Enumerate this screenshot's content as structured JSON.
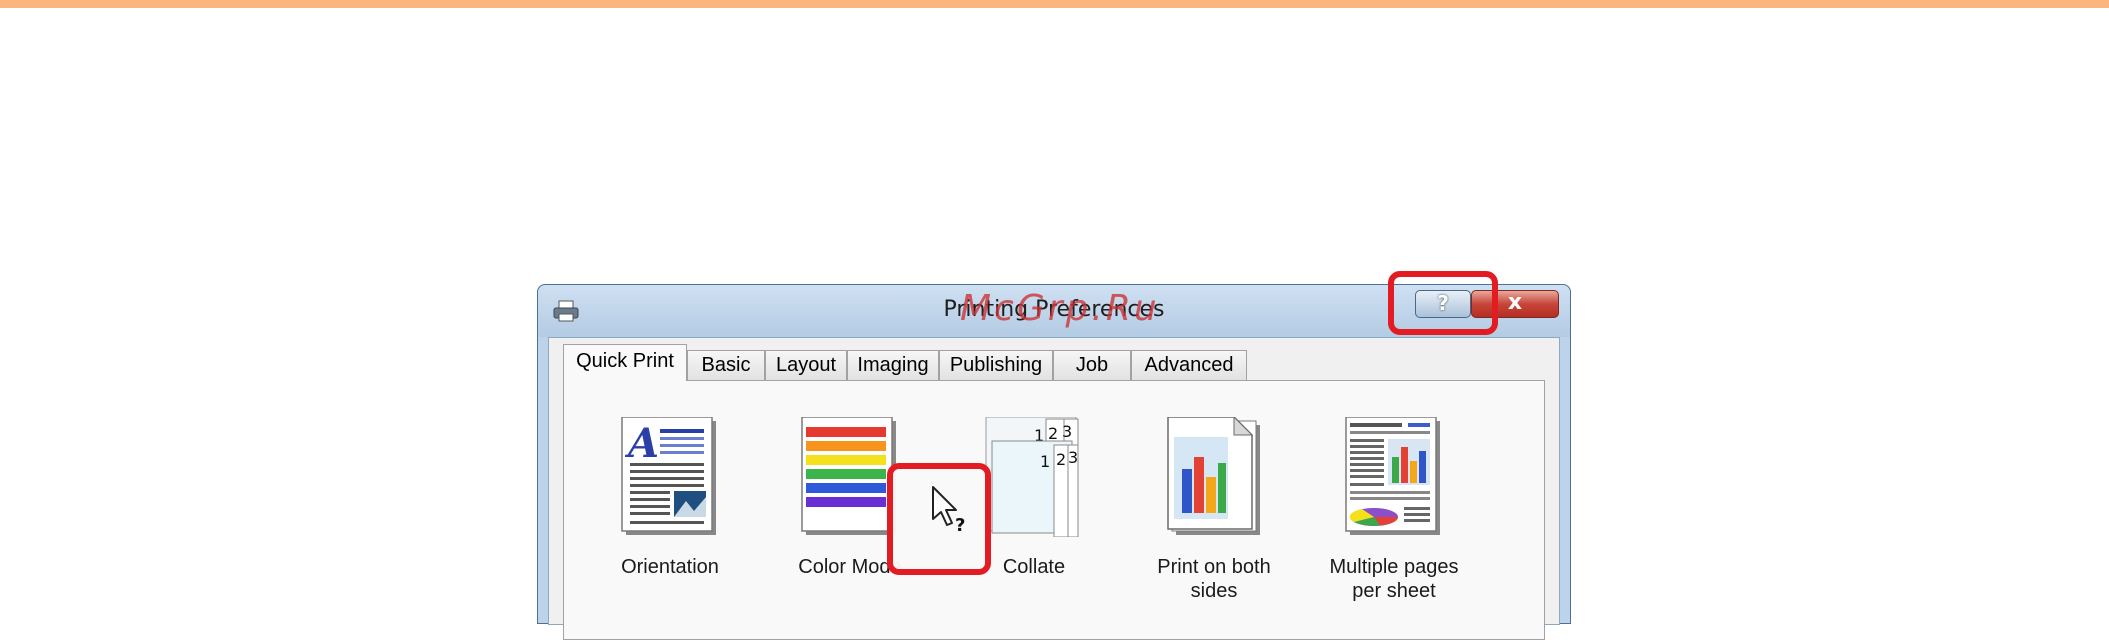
{
  "window": {
    "title": "Printing Preferences",
    "help_label": "?",
    "close_label": "x"
  },
  "tabs": [
    {
      "label": "Quick Print",
      "active": true
    },
    {
      "label": "Basic"
    },
    {
      "label": "Layout"
    },
    {
      "label": "Imaging"
    },
    {
      "label": "Publishing"
    },
    {
      "label": "Job"
    },
    {
      "label": "Advanced"
    }
  ],
  "items": [
    {
      "label": "Orientation",
      "icon": "orientation-icon"
    },
    {
      "label": "Color Mode",
      "icon": "color-mode-icon"
    },
    {
      "label": "Collate",
      "icon": "collate-icon"
    },
    {
      "label": "Print on both sides",
      "icon": "duplex-icon"
    },
    {
      "label": "Multiple pages per sheet",
      "icon": "multiple-pages-icon"
    }
  ],
  "watermark": "McGrp.Ru",
  "colors": {
    "accent_bar": "#fbb67d",
    "callout": "#e31c23",
    "title_bar": "#bcd3ea"
  }
}
